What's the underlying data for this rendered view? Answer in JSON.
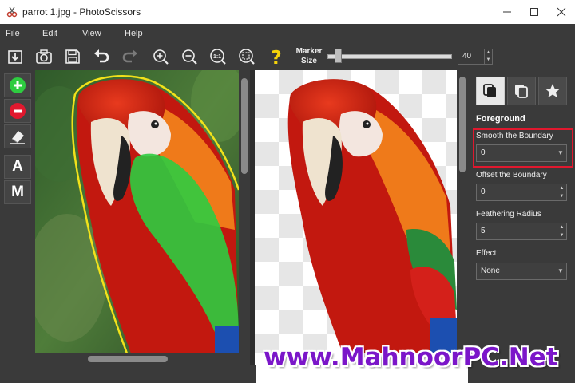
{
  "window": {
    "title": "parrot 1.jpg - PhotoScissors"
  },
  "menu": [
    "File",
    "Edit",
    "View",
    "Help"
  ],
  "toolbar": {
    "zoom_actual_label": "1:1",
    "marker_size_label_line1": "Marker",
    "marker_size_label_line2": "Size",
    "marker_size_value": "40",
    "marker_size_fraction": 0.06
  },
  "left_tools": {
    "auto_label": "A",
    "manual_label": "M"
  },
  "panel": {
    "tabs": [
      "foreground-tab",
      "background-tab",
      "effects-tab"
    ],
    "heading": "Foreground",
    "smooth_label": "Smooth the Boundary",
    "smooth_value": "0",
    "offset_label": "Offset the Boundary",
    "offset_value": "0",
    "feather_label": "Feathering Radius",
    "feather_value": "5",
    "effect_label": "Effect",
    "effect_value": "None"
  },
  "watermark": "www.MahnoorPC.Net",
  "colors": {
    "accent_highlight": "#e0182e",
    "keep_marker": "#2ecc40",
    "remove_marker": "#e0182e",
    "outline": "#f2e21a",
    "watermark": "#7b16c9"
  }
}
